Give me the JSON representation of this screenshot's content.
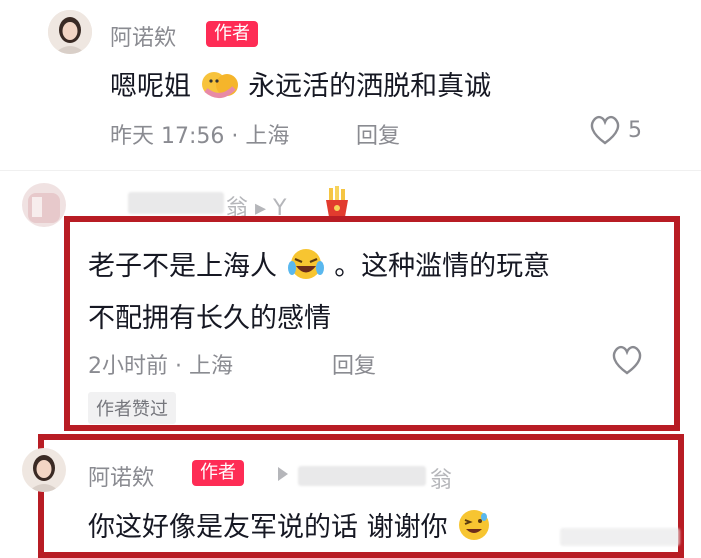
{
  "comments": [
    {
      "name": "阿诺欸",
      "badge": "作者",
      "text_prefix": "嗯呢姐",
      "text_suffix": "永远活的洒脱和真诚",
      "meta": "昨天 17:56 · 上海",
      "reply": "回复",
      "like_count": "5"
    },
    {
      "name_partial": "翁 ▸ Y",
      "line1_prefix": "老子不是上海人",
      "line1_suffix": "。这种滥情的玩意",
      "line2": "不配拥有长久的感情",
      "meta": "2小时前 · 上海",
      "reply": "回复",
      "author_liked": "作者赞过"
    },
    {
      "name": "阿诺欸",
      "badge": "作者",
      "reply_to": "翁",
      "text": "你这好像是友军说的话 谢谢你"
    }
  ],
  "colors": {
    "badge": "#fe2c55",
    "highlight_box": "#b81c24",
    "meta": "#8a8b91"
  },
  "icons": [
    "heart-outline-icon",
    "play-triangle-icon",
    "fries-emoji-icon",
    "hug-emoji-icon",
    "laugh-cry-emoji-icon",
    "wink-emoji-icon"
  ]
}
